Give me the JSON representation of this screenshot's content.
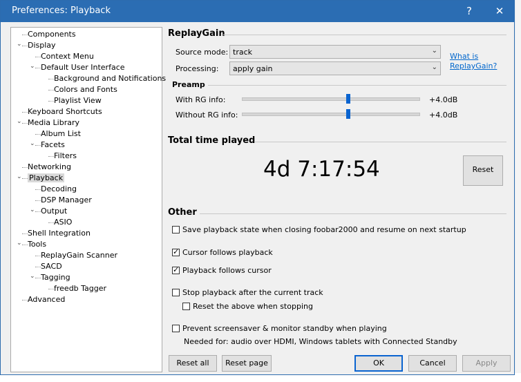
{
  "window": {
    "title": "Preferences: Playback",
    "help_glyph": "?",
    "close_glyph": "✕"
  },
  "tree": [
    {
      "label": "Components",
      "level": 0,
      "expander": ""
    },
    {
      "label": "Display",
      "level": 0,
      "expander": "v"
    },
    {
      "label": "Context Menu",
      "level": 1,
      "expander": ""
    },
    {
      "label": "Default User Interface",
      "level": 1,
      "expander": "v"
    },
    {
      "label": "Background and Notifications",
      "level": 2,
      "expander": ""
    },
    {
      "label": "Colors and Fonts",
      "level": 2,
      "expander": ""
    },
    {
      "label": "Playlist View",
      "level": 2,
      "expander": ""
    },
    {
      "label": "Keyboard Shortcuts",
      "level": 0,
      "expander": ""
    },
    {
      "label": "Media Library",
      "level": 0,
      "expander": "v"
    },
    {
      "label": "Album List",
      "level": 1,
      "expander": ""
    },
    {
      "label": "Facets",
      "level": 1,
      "expander": "v"
    },
    {
      "label": "Filters",
      "level": 2,
      "expander": ""
    },
    {
      "label": "Networking",
      "level": 0,
      "expander": ""
    },
    {
      "label": "Playback",
      "level": 0,
      "expander": "v",
      "selected": true
    },
    {
      "label": "Decoding",
      "level": 1,
      "expander": ""
    },
    {
      "label": "DSP Manager",
      "level": 1,
      "expander": ""
    },
    {
      "label": "Output",
      "level": 1,
      "expander": "v"
    },
    {
      "label": "ASIO",
      "level": 2,
      "expander": ""
    },
    {
      "label": "Shell Integration",
      "level": 0,
      "expander": ""
    },
    {
      "label": "Tools",
      "level": 0,
      "expander": "v"
    },
    {
      "label": "ReplayGain Scanner",
      "level": 1,
      "expander": ""
    },
    {
      "label": "SACD",
      "level": 1,
      "expander": ""
    },
    {
      "label": "Tagging",
      "level": 1,
      "expander": "v"
    },
    {
      "label": "freedb Tagger",
      "level": 2,
      "expander": ""
    },
    {
      "label": "Advanced",
      "level": 0,
      "expander": ""
    }
  ],
  "replaygain": {
    "title": "ReplayGain",
    "source_mode_label": "Source mode:",
    "source_mode_value": "track",
    "processing_label": "Processing:",
    "processing_value": "apply gain",
    "link_line1": "What is",
    "link_line2": "ReplayGain?",
    "preamp_title": "Preamp",
    "with_rg_label": "With RG info:",
    "with_rg_value": "+4.0dB",
    "with_rg_level": 0.6,
    "without_rg_label": "Without RG info:",
    "without_rg_value": "+4.0dB",
    "without_rg_level": 0.6
  },
  "time_played": {
    "title": "Total time played",
    "value": "4d 7:17:54",
    "reset_label": "Reset"
  },
  "other": {
    "title": "Other",
    "options": [
      {
        "label": "Save playback state when closing foobar2000 and resume on next startup",
        "checked": false
      },
      {
        "label": "Cursor follows playback",
        "checked": true
      },
      {
        "label": "Playback follows cursor",
        "checked": true
      },
      {
        "label": "Stop playback after the current track",
        "checked": false
      },
      {
        "label": "Reset the above when stopping",
        "checked": false
      },
      {
        "label": "Prevent screensaver & monitor standby when playing",
        "checked": false
      }
    ],
    "note": "Needed for: audio over HDMI, Windows tablets with Connected Standby"
  },
  "buttons": {
    "reset_all": "Reset all",
    "reset_page": "Reset page",
    "ok": "OK",
    "cancel": "Cancel",
    "apply": "Apply"
  }
}
